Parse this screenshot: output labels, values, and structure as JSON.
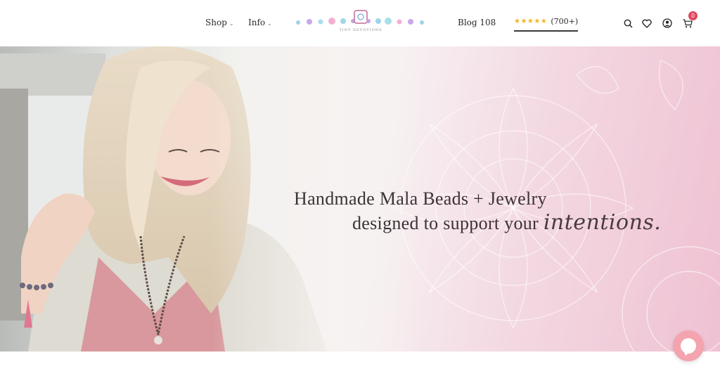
{
  "header": {
    "nav": [
      {
        "label": "Shop",
        "chevron": "chevron-down-icon"
      },
      {
        "label": "Info",
        "chevron": "chevron-down-icon"
      }
    ],
    "logo_text": "TINY DEVOTIONS",
    "blog_label": "Blog 108",
    "reviews": {
      "stars": "★★★★★",
      "count": "(700+)"
    },
    "icons": [
      "search-icon",
      "heart-icon",
      "account-icon",
      "cart-icon"
    ],
    "cart_count": "0"
  },
  "hero": {
    "line1": "Handmade Mala Beads + Jewelry",
    "line2": "designed to support your",
    "script_word": "intentions."
  },
  "colors": {
    "star": "#f3b61f",
    "badge": "#e0475f",
    "chat": "#f3a4ae",
    "hero_pink": "#efc1d2",
    "text": "#3d3236"
  }
}
